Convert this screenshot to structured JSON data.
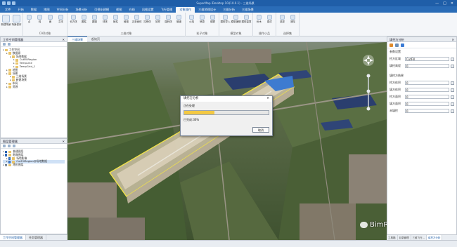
{
  "app": {
    "title": "SuperMap iDesktop 10i(10.0.1) - 三维场景",
    "window_controls": [
      "—",
      "□",
      "✕"
    ]
  },
  "menu_tabs": [
    "文件",
    "开始",
    "数据",
    "地图",
    "空间分析",
    "场景分析",
    "可视化建模",
    "视图",
    "在线",
    "风格设置",
    "飞行管理",
    "对象操作",
    "三维地理设计",
    "三维分析",
    "三维场景"
  ],
  "menu_active_index": 11,
  "ribbon": {
    "groups": [
      {
        "label": "",
        "buttons": [
          "新建场景",
          "场景保存"
        ]
      },
      {
        "label": "CAD对象",
        "buttons": [
          "点",
          "线",
          "面",
          "文本"
        ]
      },
      {
        "label": "三维对象",
        "buttons": [
          "长方体",
          "圆柱",
          "圆锥",
          "球体",
          "棱柱",
          "棱锥",
          "正多面体",
          "拉伸体",
          "放样",
          "旋转体",
          "管道"
        ]
      },
      {
        "label": "粒子对象",
        "buttons": [
          "火焰",
          "喷泉",
          "烟雾"
        ]
      },
      {
        "label": "模型对象",
        "buttons": [
          "模型导入",
          "模型编辑",
          "模型量算"
        ]
      },
      {
        "label": "操作小品",
        "buttons": [
          "树木",
          "路灯"
        ]
      },
      {
        "label": "选择集",
        "buttons": [
          "选择",
          "清除"
        ]
      }
    ]
  },
  "doc_tabs": [
    "三维场景",
    "起始页"
  ],
  "workspace_panel": {
    "title": "工作空间管理器",
    "tree": [
      {
        "level": 0,
        "text": "工作空间",
        "checked": false
      },
      {
        "level": 1,
        "text": "数据源",
        "checked": false
      },
      {
        "level": 2,
        "text": "场地数据",
        "checked": false
      },
      {
        "level": 3,
        "text": "CutFillRegion",
        "checked": false
      },
      {
        "level": 3,
        "text": "TempLine",
        "checked": false
      },
      {
        "level": 3,
        "text": "TempGrid_1",
        "checked": false
      },
      {
        "level": 1,
        "text": "地图",
        "checked": false
      },
      {
        "level": 1,
        "text": "场景",
        "checked": false
      },
      {
        "level": 2,
        "text": "三维场景",
        "checked": false
      },
      {
        "level": 2,
        "text": "新建场景",
        "checked": false
      },
      {
        "level": 1,
        "text": "布局",
        "checked": false
      },
      {
        "level": 1,
        "text": "资源",
        "checked": false
      }
    ]
  },
  "layer_panel": {
    "title": "图层管理器",
    "tree": [
      {
        "level": 0,
        "text": "普通图层",
        "checked": true
      },
      {
        "level": 0,
        "text": "影像图层",
        "checked": true
      },
      {
        "level": 1,
        "text": "场地影像",
        "checked": true
      },
      {
        "level": 1,
        "text": "CutFillRegion@场地数据",
        "checked": true,
        "selected": true
      },
      {
        "level": 0,
        "text": "地形图层",
        "checked": false
      }
    ]
  },
  "left_bottom_tabs": [
    "工作空间管理器",
    "任务管理器"
  ],
  "dialog": {
    "title": "填挖方分析",
    "label": "正在处理",
    "progress": 0.36,
    "progress_text": "已完成:36%",
    "cancel": "取消"
  },
  "right_panel": {
    "title": "填挖方分析",
    "section_params": "参数设置",
    "fields": [
      {
        "label": "挖方区域",
        "value": "CutFill"
      },
      {
        "label": "填挖高程",
        "value": "0"
      }
    ],
    "section_results": "填挖方结果",
    "results": [
      {
        "label": "挖方体积",
        "value": "0"
      },
      {
        "label": "填方体积",
        "value": "0"
      },
      {
        "label": "挖方面积",
        "value": "0"
      },
      {
        "label": "填方面积",
        "value": "0"
      },
      {
        "label": "未填挖",
        "value": "0"
      }
    ],
    "bottom_tabs": [
      "工具箱",
      "目录管理",
      "三维飞行...",
      "填挖方分析"
    ]
  },
  "watermark": "BimRocket",
  "colors": {
    "title_bar": "#1f5ea8",
    "menu_bar": "#2a6cb7",
    "progress_fill": "#f3c843",
    "site_outline": "#f1e24a"
  }
}
